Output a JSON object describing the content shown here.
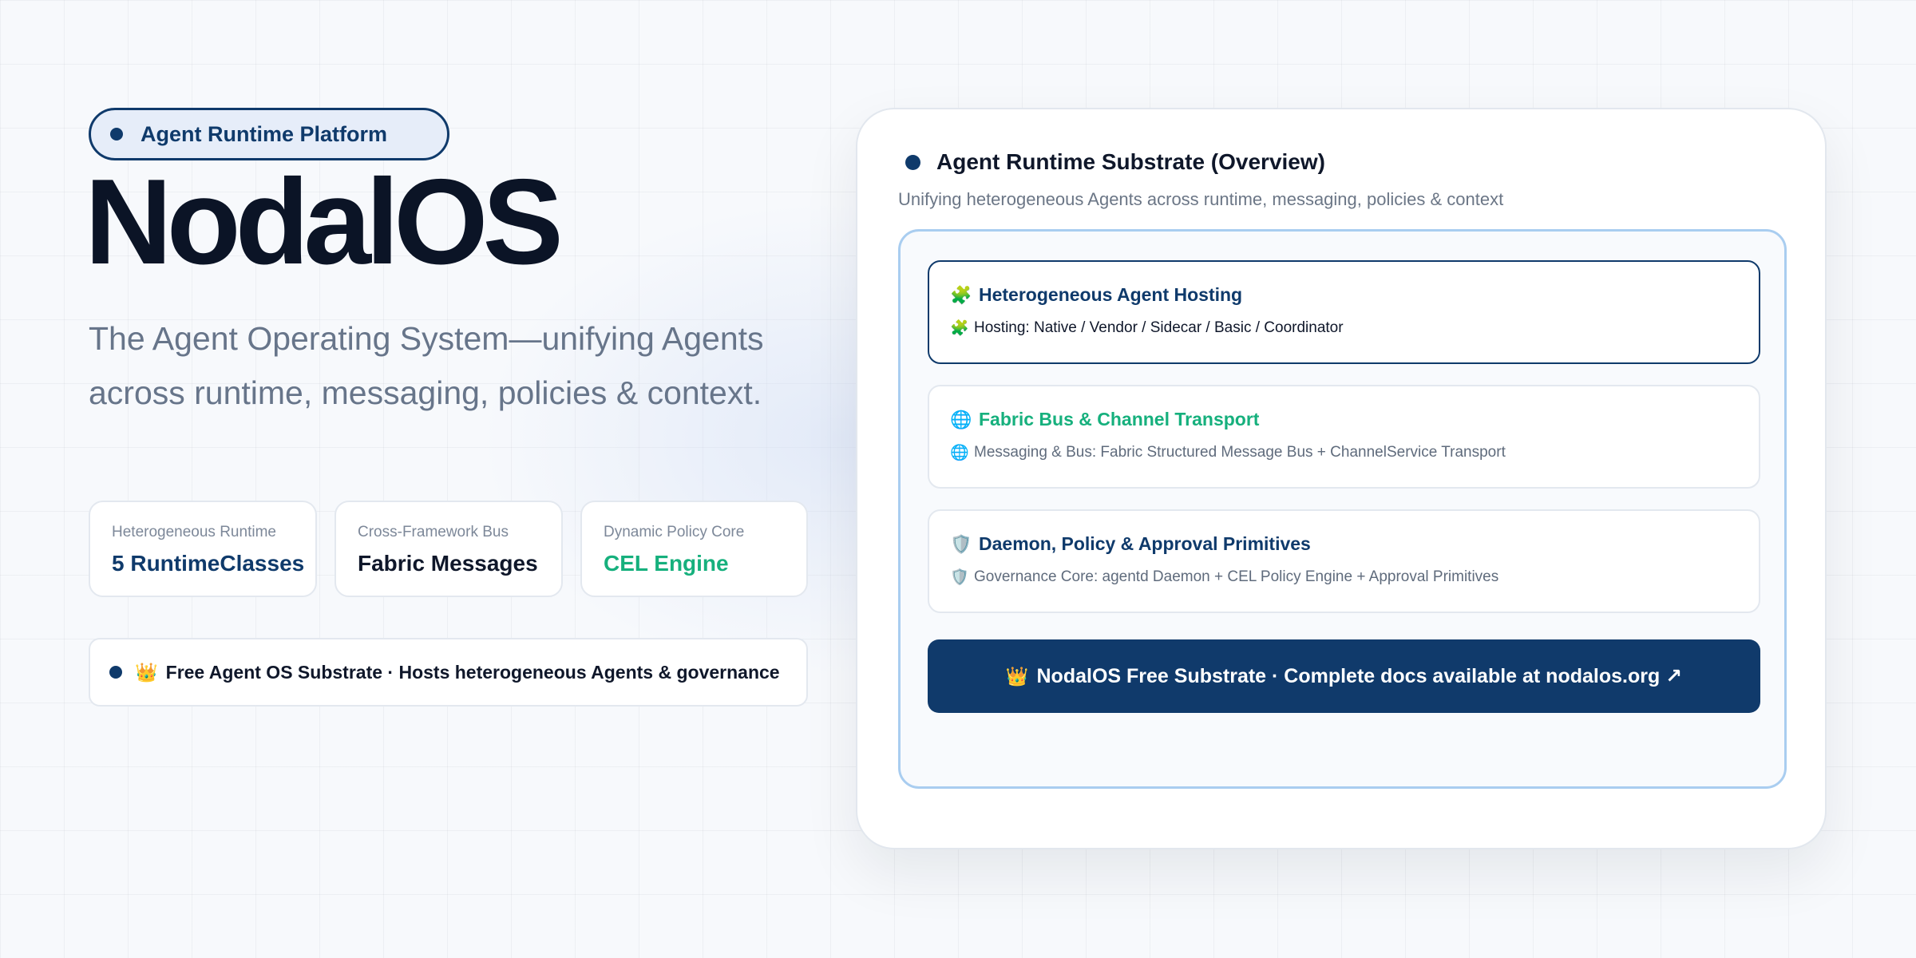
{
  "colors": {
    "primary": "#0f3a6b",
    "accent_green": "#16b07d",
    "text_dark": "#0f172a",
    "muted": "#67758a",
    "inner_border": "#a9cdf0"
  },
  "hero": {
    "badge": "Agent Runtime Platform",
    "brand": "NodalOS",
    "tagline": "The Agent Operating System—unifying Agents across runtime, messaging, policies & context."
  },
  "stats": [
    {
      "caption": "Heterogeneous Runtime",
      "value": "5 RuntimeClasses",
      "color": "#0f3a6b"
    },
    {
      "caption": "Cross-Framework Bus",
      "value": "Fabric Messages",
      "color": "#0f172a"
    },
    {
      "caption": "Dynamic Policy Core",
      "value": "CEL Engine",
      "color": "#16b07d"
    }
  ],
  "notice": {
    "icon": "crown-icon",
    "emoji": "👑",
    "text": "Free Agent OS Substrate · Hosts heterogeneous Agents & governance"
  },
  "card": {
    "title": "Agent Runtime Substrate (Overview)",
    "subtitle": "Unifying heterogeneous Agents across runtime, messaging, policies & context",
    "items": [
      {
        "icon": "puzzle-icon",
        "emoji": "🧩",
        "heading": "Heterogeneous Agent Hosting",
        "desc": "Hosting: Native / Vendor / Sidecar / Basic / Coordinator",
        "heading_color": "#0f3a6b",
        "desc_color": "#0f172a",
        "active": true
      },
      {
        "icon": "globe-icon",
        "emoji": "🌐",
        "heading": "Fabric Bus & Channel Transport",
        "desc": "Messaging & Bus: Fabric Structured Message Bus + ChannelService Transport",
        "heading_color": "#16b07d",
        "desc_color": "#5f6b7c",
        "active": false
      },
      {
        "icon": "shield-icon",
        "emoji": "🛡️",
        "heading": "Daemon, Policy & Approval Primitives",
        "desc": "Governance Core: agentd Daemon + CEL Policy Engine + Approval Primitives",
        "heading_color": "#0f3a6b",
        "desc_color": "#5f6b7c",
        "active": false
      }
    ],
    "cta": {
      "icon": "crown-icon",
      "emoji": "👑",
      "label": "NodalOS Free Substrate · Complete docs available at nodalos.org ↗"
    }
  }
}
